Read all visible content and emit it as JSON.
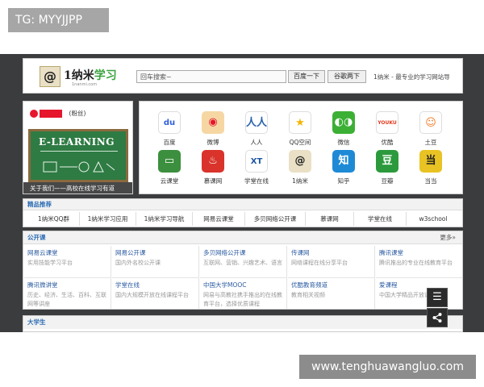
{
  "overlay": {
    "top_badge": "TG: MYYJJPP",
    "bottom_watermark": "www.tenghuawangluo.com"
  },
  "header": {
    "logo_mark": "@",
    "logo_text_prefix": "1纳米",
    "logo_text_suffix": "学习",
    "logo_sub": "1nanmi.com",
    "search_placeholder": "回车搜索~",
    "baidu_button": "百度一下",
    "google_button": "谷歌两下",
    "slogan": "1纳米 - 最专业的学习网站导"
  },
  "banner": {
    "fans_label": "(粉丝)",
    "board_title": "E-LEARNING",
    "caption": "关于我们——高校在线学习有道"
  },
  "apps": [
    {
      "label": "百度",
      "glyph": "du",
      "color": "#2f5fd8",
      "bg": "#ffffff",
      "icon": "baidu-icon"
    },
    {
      "label": "微博",
      "glyph": "◉",
      "color": "#e6162d",
      "bg": "#f6d7a3",
      "icon": "weibo-icon"
    },
    {
      "label": "人人",
      "glyph": "人人",
      "color": "#2a62ad",
      "bg": "#ffffff",
      "icon": "renren-icon"
    },
    {
      "label": "QQ空间",
      "glyph": "★",
      "color": "#f5b400",
      "bg": "#ffffff",
      "icon": "qzone-icon"
    },
    {
      "label": "微信",
      "glyph": "◐◑",
      "color": "#ffffff",
      "bg": "#3cb035",
      "icon": "wechat-icon"
    },
    {
      "label": "优酷",
      "glyph": "YOUKU",
      "color": "#e23a1e",
      "bg": "#ffffff",
      "icon": "youku-icon"
    },
    {
      "label": "土豆",
      "glyph": "☺",
      "color": "#f27b26",
      "bg": "#ffffff",
      "icon": "tudou-icon"
    },
    {
      "label": "云课堂",
      "glyph": "▭",
      "color": "#ffffff",
      "bg": "#3c8f3e",
      "icon": "cloud-classroom-icon"
    },
    {
      "label": "慕课网",
      "glyph": "♨",
      "color": "#ffffff",
      "bg": "#d9332b",
      "icon": "imooc-icon"
    },
    {
      "label": "学堂在线",
      "glyph": "XT",
      "color": "#1f57a6",
      "bg": "#ffffff",
      "icon": "xuetangx-icon"
    },
    {
      "label": "1纳米",
      "glyph": "@",
      "color": "#222222",
      "bg": "#e9e0c6",
      "icon": "1nanmi-icon"
    },
    {
      "label": "知乎",
      "glyph": "知",
      "color": "#ffffff",
      "bg": "#1e8ad6",
      "icon": "zhihu-icon"
    },
    {
      "label": "豆瓣",
      "glyph": "豆",
      "color": "#ffffff",
      "bg": "#2c9a3c",
      "icon": "douban-icon"
    },
    {
      "label": "当当",
      "glyph": "当",
      "color": "#222222",
      "bg": "#e8c323",
      "icon": "dangdang-icon"
    }
  ],
  "recommend": {
    "title": "精品推荐",
    "items": [
      "1纳米QQ群",
      "1纳米学习应用",
      "1纳米学习导航",
      "网易云课堂",
      "多贝网络公开课",
      "慕课网",
      "学堂在线",
      "w3school"
    ]
  },
  "open_courses": {
    "title": "公开课",
    "more": "更多»",
    "items": [
      {
        "name": "网易云课堂",
        "desc": "实用技能学习平台"
      },
      {
        "name": "网易公开课",
        "desc": "国内外名校公开课"
      },
      {
        "name": "多贝网络公开课",
        "desc": "互联网、营销、兴趣艺术、语言"
      },
      {
        "name": "传课网",
        "desc": "网络课程在线分享平台"
      },
      {
        "name": "腾讯课堂",
        "desc": "腾讯推出的专业在线教育平台"
      },
      {
        "name": "腾讯微讲堂",
        "desc": "历史、经济、生活、百科、互联网等讲座"
      },
      {
        "name": "学堂在线",
        "desc": "国内大规模开放在线课程平台"
      },
      {
        "name": "中国大学MOOC",
        "desc": "网易与高教社携手推出的在线教育平台，选择优质课程"
      },
      {
        "name": "优酷教育频道",
        "desc": "教育相关视频"
      },
      {
        "name": "爱课程",
        "desc": "中国大学精品开放课程"
      }
    ]
  },
  "college": {
    "title": "大学生"
  },
  "side_buttons": {
    "list_glyph": "☰",
    "share_glyph": "⋖"
  }
}
